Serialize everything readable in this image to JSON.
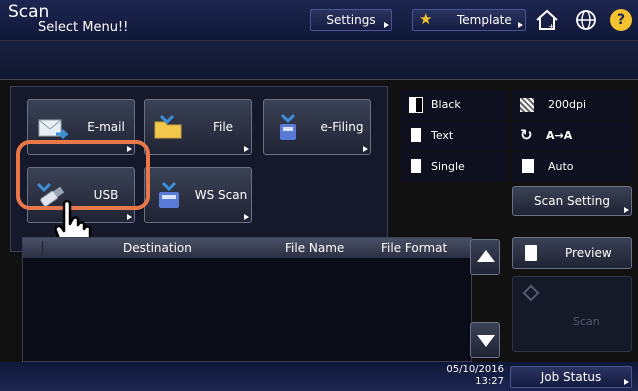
{
  "header": {
    "title": "Scan",
    "subtitle": "Select Menu!!",
    "settings_label": "Settings",
    "template_label": "Template"
  },
  "functions": [
    {
      "label": "E-mail"
    },
    {
      "label": "File"
    },
    {
      "label": "e-Filing"
    },
    {
      "label": "USB"
    },
    {
      "label": "WS Scan"
    }
  ],
  "scan_settings": {
    "color": "Black",
    "resolution": "200dpi",
    "mode": "Text",
    "rotation": "A→A",
    "sides": "Single",
    "size": "Auto",
    "scan_setting_label": "Scan Setting"
  },
  "destination_table": {
    "columns": [
      "Destination",
      "File Name",
      "File Format"
    ]
  },
  "actions": {
    "preview_label": "Preview",
    "scan_label": "Scan"
  },
  "footer": {
    "date": "05/10/2016",
    "time": "13:27",
    "job_status_label": "Job Status"
  },
  "colors": {
    "highlight": "#e8784a",
    "accent": "#2a3460"
  }
}
